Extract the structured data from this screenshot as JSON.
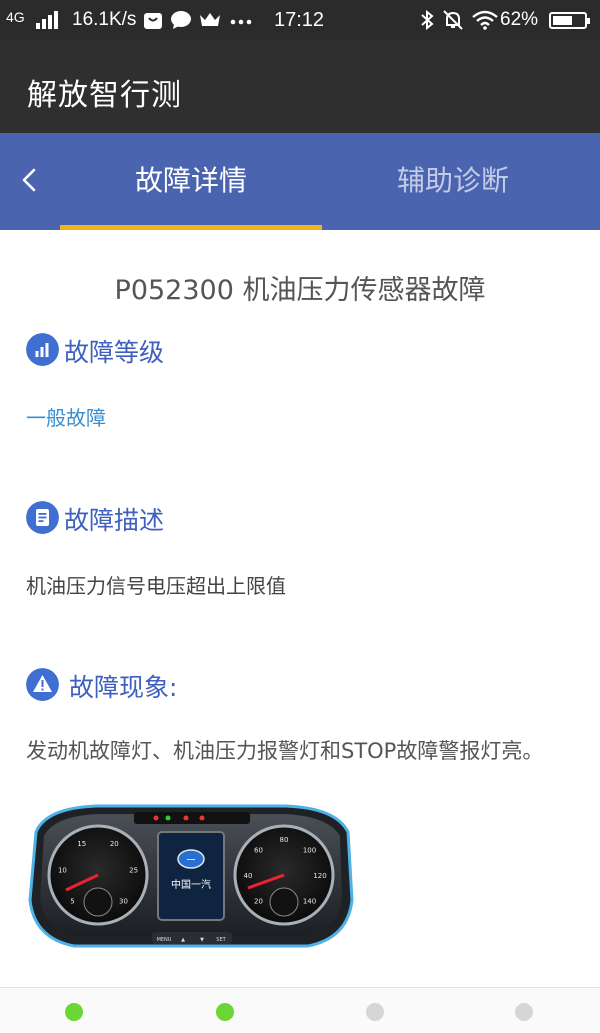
{
  "status_bar": {
    "network": "4G",
    "speed": "16.1K/s",
    "time": "17:12",
    "battery": "62%",
    "battery_level": 0.62
  },
  "header": {
    "title": "解放智行测"
  },
  "tabs": [
    {
      "label": "故障详情",
      "active": true
    },
    {
      "label": "辅助诊断",
      "active": false
    }
  ],
  "fault": {
    "title": "P052300 机油压力传感器故障",
    "level_heading": "故障等级",
    "level_value": "一般故障",
    "desc_heading": "故障描述",
    "desc_value": "机油压力信号电压超出上限值",
    "symptom_heading": "故障现象:",
    "symptom_value": "发动机故障灯、机油压力报警灯和STOP故障警报灯亮。",
    "dashboard": {
      "brand": "中国一汽",
      "buttons": [
        "MENU",
        "▲",
        "▼",
        "SET"
      ],
      "tach_ticks": [
        "5",
        "10",
        "15",
        "20",
        "25",
        "30"
      ],
      "speed_ticks": [
        "20",
        "40",
        "60",
        "80",
        "100",
        "120",
        "140"
      ]
    }
  },
  "pager": [
    true,
    true,
    false,
    false
  ],
  "colors": {
    "tab_bar": "#4a64b0",
    "accent_underline": "#f2b418",
    "section_heading": "#3e5fbf",
    "level_text": "#3b8fd0",
    "dot_active": "#6cd635",
    "dot_inactive": "#d6d6d6"
  }
}
